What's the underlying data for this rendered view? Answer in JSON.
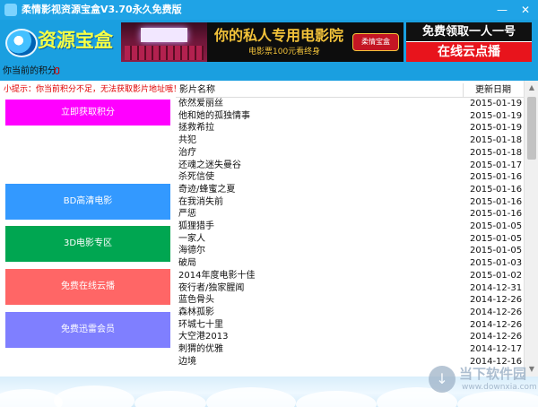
{
  "window": {
    "title": "柔情影视资源宝盒V3.70永久免费版",
    "minimize_glyph": "—",
    "close_glyph": "✕"
  },
  "header": {
    "logo_text": "资源宝盒",
    "banner_main": "你的私人专用电影院",
    "banner_sub": "电影票100元看终身",
    "banner_badge": "柔情宝盒",
    "promo_top": "免费领取一人一号",
    "promo_bottom": "在线云点播"
  },
  "points": {
    "label": "你当前的积分：",
    "value": "0"
  },
  "sidebar": {
    "tip": "小提示：你当前积分不足，无法获取影片地址哦！",
    "buttons": [
      {
        "label": "立即获取积分",
        "color": "#ff00ff"
      },
      {
        "label": "BD高清电影",
        "color": "#3399ff"
      },
      {
        "label": "3D电影专区",
        "color": "#00a651"
      },
      {
        "label": "免费在线云播",
        "color": "#ff6666"
      },
      {
        "label": "免费迅雷会员",
        "color": "#7f7fff"
      }
    ]
  },
  "list": {
    "columns": {
      "name": "影片名称",
      "date": "更新日期"
    },
    "rows": [
      {
        "name": "依然爱丽丝",
        "date": "2015-01-19"
      },
      {
        "name": "他和她的孤独情事",
        "date": "2015-01-19"
      },
      {
        "name": "拯救希拉",
        "date": "2015-01-19"
      },
      {
        "name": "共犯",
        "date": "2015-01-18"
      },
      {
        "name": "治疗",
        "date": "2015-01-18"
      },
      {
        "name": "还魂之迷失曼谷",
        "date": "2015-01-17"
      },
      {
        "name": "杀死信使",
        "date": "2015-01-16"
      },
      {
        "name": "奇迹/蜂蜜之夏",
        "date": "2015-01-16"
      },
      {
        "name": "在我消失前",
        "date": "2015-01-16"
      },
      {
        "name": "严惩",
        "date": "2015-01-16"
      },
      {
        "name": "狐狸猎手",
        "date": "2015-01-05"
      },
      {
        "name": "一家人",
        "date": "2015-01-05"
      },
      {
        "name": "海德尔",
        "date": "2015-01-05"
      },
      {
        "name": "破局",
        "date": "2015-01-03"
      },
      {
        "name": "2014年度电影十佳",
        "date": "2015-01-02"
      },
      {
        "name": "夜行者/独家腥闻",
        "date": "2014-12-31"
      },
      {
        "name": "蓝色骨头",
        "date": "2014-12-26"
      },
      {
        "name": "森林孤影",
        "date": "2014-12-26"
      },
      {
        "name": "环城七十里",
        "date": "2014-12-26"
      },
      {
        "name": "大空港2013",
        "date": "2014-12-26"
      },
      {
        "name": "刺猬的优雅",
        "date": "2014-12-17"
      },
      {
        "name": "边境",
        "date": "2014-12-16"
      }
    ]
  },
  "scrollbar": {
    "up_glyph": "▲",
    "down_glyph": "▼"
  },
  "watermark": {
    "icon_glyph": "↓",
    "text": "当下软件园",
    "url": "www.downxia.com"
  },
  "colors": {
    "titlebar": "#1fa3e6",
    "header_bg": "#1a9fe0",
    "points_value": "#e00000",
    "tip_text": "#e00000"
  }
}
